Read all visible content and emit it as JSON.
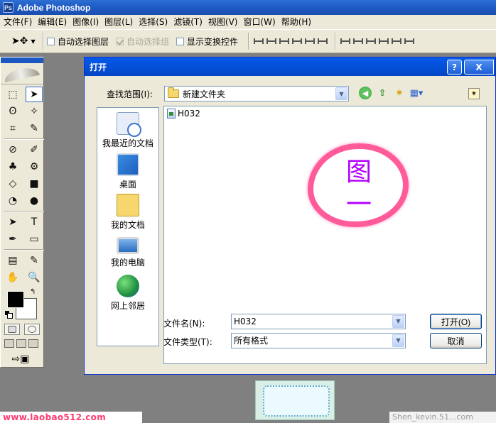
{
  "app": {
    "title": "Adobe Photoshop",
    "icon": "photoshop-icon"
  },
  "menu": [
    "文件(F)",
    "编辑(E)",
    "图像(I)",
    "图层(L)",
    "选择(S)",
    "滤镜(T)",
    "视图(V)",
    "窗口(W)",
    "帮助(H)"
  ],
  "options": {
    "auto_select_layer": "自动选择图层",
    "auto_select_group": "自动选择组",
    "show_transform": "显示变换控件"
  },
  "toolbox": {
    "tools": [
      "⬚",
      "➤",
      "ʘ",
      "✧",
      "⌗",
      "✎",
      "⊘",
      "✐",
      "♣",
      "⚙",
      "◇",
      "■",
      "◔",
      "●",
      "➤",
      "T",
      "✒",
      "▭",
      "▤",
      "✎",
      "✋",
      "🔍"
    ]
  },
  "dialog": {
    "title": "打开",
    "look_in_label": "查找范围(I):",
    "look_in_value": "新建文件夹",
    "places": [
      "我最近的文档",
      "桌面",
      "我的文档",
      "我的电脑",
      "网上邻居"
    ],
    "files": [
      {
        "name": "H032"
      }
    ],
    "annotation": "图一",
    "file_name_label": "文件名(N):",
    "file_name_value": "H032",
    "file_type_label": "文件类型(T):",
    "file_type_value": "所有格式",
    "open_button": "打开(O)",
    "cancel_button": "取消",
    "help_button": "?",
    "close_button": "X"
  },
  "watermarks": {
    "left": "www.laobao512.com",
    "right": "Shen_kevin.51...com"
  }
}
